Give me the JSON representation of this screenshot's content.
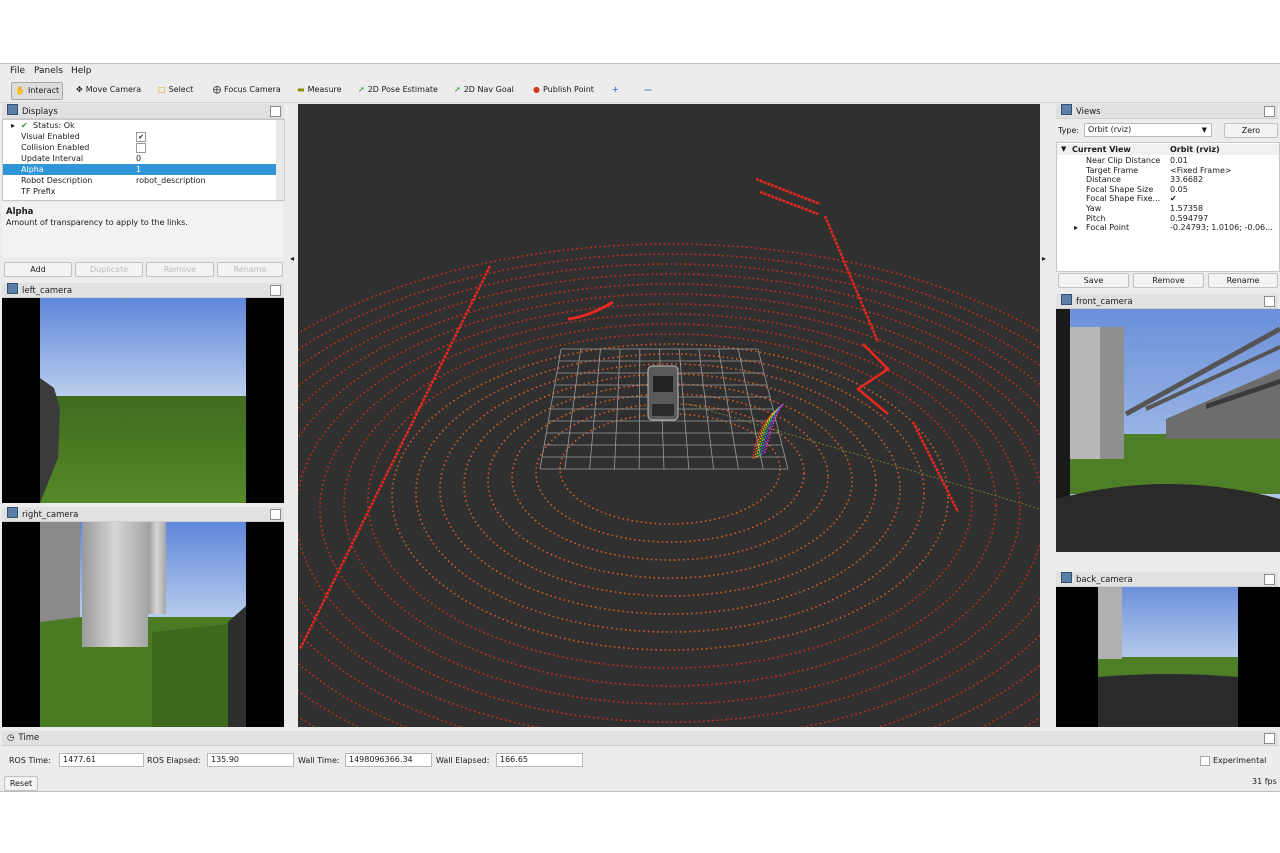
{
  "menu": [
    "File",
    "Panels",
    "Help"
  ],
  "toolbar": {
    "interact": "Interact",
    "move_camera": "Move Camera",
    "select": "Select",
    "focus_camera": "Focus Camera",
    "measure": "Measure",
    "pose_estimate": "2D Pose Estimate",
    "nav_goal": "2D Nav Goal",
    "publish_point": "Publish Point"
  },
  "displays": {
    "title": "Displays",
    "rows": [
      {
        "key": "Status: Ok",
        "value": ""
      },
      {
        "key": "Visual Enabled",
        "value": "✔"
      },
      {
        "key": "Collision Enabled",
        "value": ""
      },
      {
        "key": "Update Interval",
        "value": "0"
      },
      {
        "key": "Alpha",
        "value": "1"
      },
      {
        "key": "Robot Description",
        "value": "robot_description"
      },
      {
        "key": "TF Prefix",
        "value": ""
      }
    ],
    "help_title": "Alpha",
    "help_text": "Amount of transparency to apply to the links.",
    "buttons": {
      "add": "Add",
      "duplicate": "Duplicate",
      "remove": "Remove",
      "rename": "Rename"
    }
  },
  "left_camera": {
    "title": "left_camera"
  },
  "right_camera": {
    "title": "right_camera"
  },
  "views": {
    "title": "Views",
    "type_label": "Type:",
    "type_value": "Orbit (rviz)",
    "zero": "Zero",
    "header": {
      "key": "Current View",
      "value": "Orbit (rviz)"
    },
    "rows": [
      {
        "key": "Near Clip Distance",
        "value": "0.01"
      },
      {
        "key": "Target Frame",
        "value": "<Fixed Frame>"
      },
      {
        "key": "Distance",
        "value": "33.6682"
      },
      {
        "key": "Focal Shape Size",
        "value": "0.05"
      },
      {
        "key": "Focal Shape Fixe...",
        "value": "✔"
      },
      {
        "key": "Yaw",
        "value": "1.57358"
      },
      {
        "key": "Pitch",
        "value": "0.594797"
      },
      {
        "key": "Focal Point",
        "value": "-0.24793; 1.0106; -0.06..."
      }
    ],
    "buttons": {
      "save": "Save",
      "remove": "Remove",
      "rename": "Rename"
    }
  },
  "front_camera": {
    "title": "front_camera"
  },
  "back_camera": {
    "title": "back_camera"
  },
  "time": {
    "title": "Time",
    "ros_time_label": "ROS Time:",
    "ros_time": "1477.61",
    "ros_elapsed_label": "ROS Elapsed:",
    "ros_elapsed": "135.90",
    "wall_time_label": "Wall Time:",
    "wall_time": "1498096366.34",
    "wall_elapsed_label": "Wall Elapsed:",
    "wall_elapsed": "166.65",
    "experimental": "Experimental",
    "reset": "Reset",
    "fps": "31 fps"
  },
  "colors": {
    "selection": "#3096d8",
    "viewport_bg": "#303030",
    "laser": "#e8281e",
    "pointcloud": "#e0552a"
  }
}
